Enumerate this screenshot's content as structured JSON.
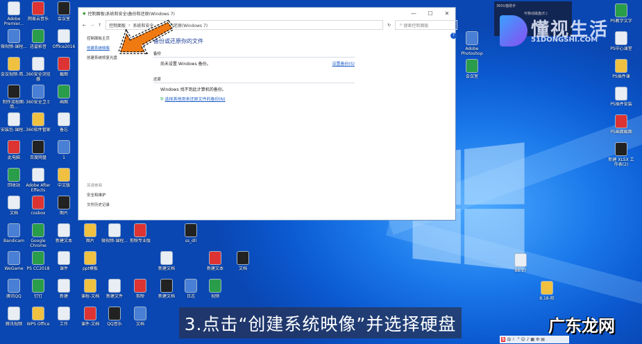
{
  "window": {
    "title": "控制面板\\系统和安全\\备份和还原(Windows 7)",
    "breadcrumb": [
      "控制面板",
      "系统和安全",
      "备份和还原(Windows 7)"
    ],
    "search_placeholder": "搜索控制面板",
    "minimize": "—",
    "maximize": "☐",
    "close": "✕",
    "sidebar": {
      "home": "控制面板主页",
      "links": [
        "创建系统映像",
        "创建系统修复光盘"
      ],
      "see_also": "另请参阅",
      "see_also_links": [
        "安全和维护",
        "文件历史记录"
      ]
    },
    "main": {
      "title": "备份或还原你的文件",
      "backup_section": "备份",
      "backup_status": "尚未设置 Windows 备份。",
      "setup_backup": "设置备份(S)",
      "restore_section": "还原",
      "restore_status": "Windows 找不到此计算机的备份。",
      "restore_link": "选择其他用来还原文件的备份(N)"
    }
  },
  "caption": "3.点击“创建系统映像”并选择硬盘",
  "notification": {
    "title": "360U盘助手",
    "line": "可移动磁盘(E:)"
  },
  "watermark": {
    "brand": "懂视生活",
    "site": "51DONGSHI.COM",
    "corner": "广东龙网"
  },
  "ime": {
    "label": "中"
  },
  "desktop": {
    "icons": [
      "Adobe Premier...",
      "网易云音乐",
      "会议室",
      "微视频-课程...",
      "迅雷影音",
      "Office2016",
      "会议视频-简...",
      "360安全浏览器",
      "截图",
      "制作流程图-简...",
      "360安全卫士",
      "画图",
      "安装包-课程...",
      "360软件管家",
      "备忘",
      "此电脑",
      "百度网盘",
      "1",
      "回收站",
      "Adobe After Effects",
      "中文版",
      "文档",
      "cosbox",
      "图片",
      "Bandicam",
      "Google Chrome",
      "新建文本",
      "图片",
      "微视频-课程...",
      "剪映专业版",
      "ss_dll",
      "WeGame",
      "PS CC2018",
      "课件",
      "ppt模板",
      "新建文档",
      "新建文本",
      "文档",
      "腾讯QQ",
      "钉钉",
      "新建",
      "课程-文档",
      "新建文件",
      "剪映",
      "新建文档",
      "日志",
      "视频",
      "腾讯视频",
      "WPS Office",
      "工作",
      "课件-文档",
      "QQ音乐",
      "文档",
      "PS教学文字",
      "PS中心课堂",
      "PS插件课",
      "PS插件安装",
      "PS画面截图",
      "新建 XLSX 工作表(2)",
      "Adobe Photoshop",
      "会议室",
      "88.17",
      "8.18-检"
    ]
  }
}
